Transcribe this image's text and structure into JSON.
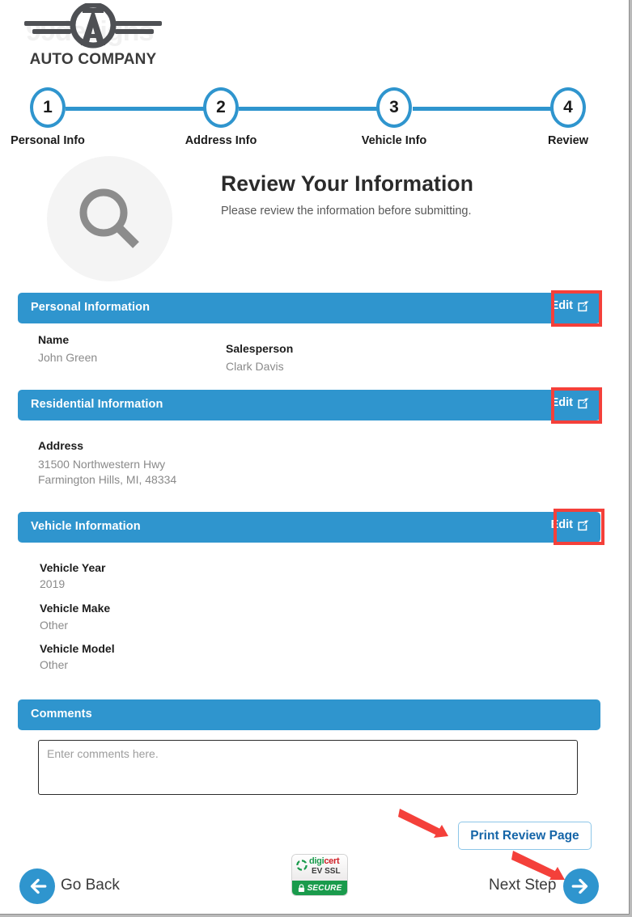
{
  "brand": {
    "company_name": "AUTO COMPANY",
    "watermark_text": "99designs",
    "logo_letter": "A"
  },
  "stepper": {
    "steps": [
      {
        "number": "1",
        "label": "Personal Info"
      },
      {
        "number": "2",
        "label": "Address Info"
      },
      {
        "number": "3",
        "label": "Vehicle Info"
      },
      {
        "number": "4",
        "label": "Review"
      }
    ],
    "active_index": 4,
    "color": "#2f95ce"
  },
  "hero": {
    "icon": "magnifier-icon",
    "title": "Review Your Information",
    "subtitle": "Please review the information before submitting."
  },
  "sections": [
    {
      "title": "Personal Information",
      "edit_label": "Edit",
      "highlighted": true,
      "fields": [
        {
          "label": "Name",
          "value": "John Green"
        },
        {
          "label": "Salesperson",
          "value": "Clark Davis"
        }
      ]
    },
    {
      "title": "Residential Information",
      "edit_label": "Edit",
      "highlighted": true,
      "fields": [
        {
          "label": "Address",
          "value": "31500 Northwestern Hwy"
        },
        {
          "label": "",
          "value": "Farmington Hills, MI, 48334"
        }
      ]
    },
    {
      "title": "Vehicle Information",
      "edit_label": "Edit",
      "highlighted": true,
      "fields": [
        {
          "label": "Vehicle Year",
          "value": "2019"
        },
        {
          "label": "Vehicle Make",
          "value": "Other"
        },
        {
          "label": "Vehicle Model",
          "value": "Other"
        }
      ]
    }
  ],
  "comments": {
    "title": "Comments",
    "placeholder": "Enter comments here.",
    "value": ""
  },
  "footer": {
    "print_label": "Print Review Page",
    "back_label": "Go Back",
    "next_label": "Next Step",
    "seal": {
      "brand_first": "digi",
      "brand_second": "cert",
      "cert_type": "EV SSL",
      "status": "SECURE"
    }
  },
  "colors": {
    "accent_blue": "#2f95ce",
    "highlight_red": "#f4403a",
    "seal_green": "#1a9b4c",
    "seal_red": "#cf2027"
  }
}
